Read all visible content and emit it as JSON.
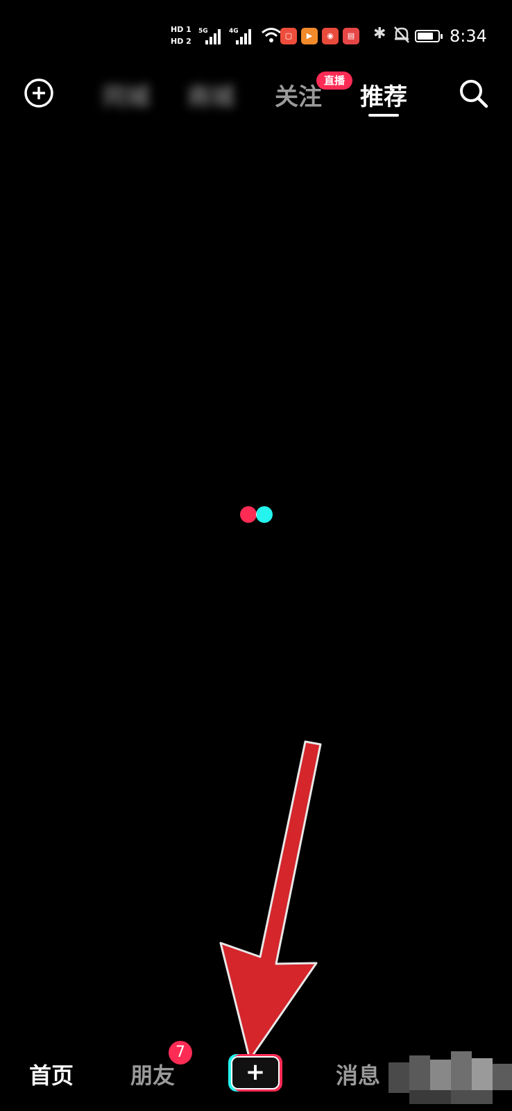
{
  "status_bar": {
    "hd1": "HD 1",
    "hd2": "HD 2",
    "net1": "5G",
    "net2": "4G",
    "app_icons": [
      "Tmall-icon",
      "video-icon",
      "618-icon",
      "book-icon"
    ],
    "time": "8:34"
  },
  "top_nav": {
    "tabs": [
      {
        "label": "同城",
        "state": "blurred"
      },
      {
        "label": "商城",
        "state": "blurred"
      },
      {
        "label": "关注",
        "state": "inactive"
      },
      {
        "label": "推荐",
        "state": "active"
      }
    ],
    "live_badge": "直播"
  },
  "bottom_nav": {
    "items": [
      {
        "label": "首页",
        "state": "active"
      },
      {
        "label": "朋友",
        "state": "inactive",
        "badge": "7"
      },
      {
        "label": "消息",
        "state": "inactive"
      }
    ],
    "create_button": "+"
  },
  "colors": {
    "accent_red": "#fe2c55",
    "accent_cyan": "#25f4ee",
    "annotation_arrow": "#d4262b"
  }
}
